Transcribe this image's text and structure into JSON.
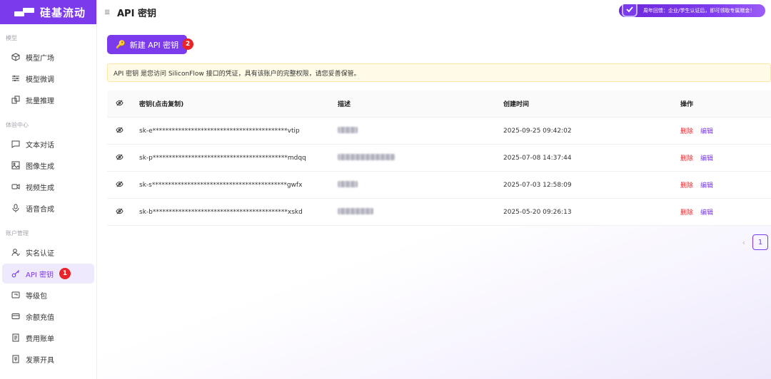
{
  "brand": {
    "name": "硅基流动"
  },
  "header": {
    "title": "API 密钥",
    "promo_text": "周年回馈：企业/学生认证后，即可领取专属赠金！"
  },
  "sidebar": {
    "sections": [
      {
        "title": "模型",
        "items": [
          {
            "label": "模型广场",
            "icon": "cube-icon"
          },
          {
            "label": "模型微调",
            "icon": "sliders-icon"
          },
          {
            "label": "批量推理",
            "icon": "layers-icon"
          }
        ]
      },
      {
        "title": "体验中心",
        "items": [
          {
            "label": "文本对话",
            "icon": "chat-icon"
          },
          {
            "label": "图像生成",
            "icon": "image-icon"
          },
          {
            "label": "视频生成",
            "icon": "video-icon"
          },
          {
            "label": "语音合成",
            "icon": "mic-icon"
          }
        ]
      },
      {
        "title": "账户管理",
        "items": [
          {
            "label": "实名认证",
            "icon": "user-check-icon"
          },
          {
            "label": "API 密钥",
            "icon": "key-icon",
            "active": true,
            "badge": "1"
          },
          {
            "label": "等级包",
            "icon": "package-icon"
          },
          {
            "label": "余额充值",
            "icon": "card-icon"
          },
          {
            "label": "费用账单",
            "icon": "bill-icon"
          },
          {
            "label": "发票开具",
            "icon": "invoice-icon"
          }
        ]
      }
    ]
  },
  "main": {
    "create_button": {
      "label": "新建 API 密钥",
      "badge": "2"
    },
    "notice": "API 密钥 是您访问 SiliconFlow 接口的凭证，具有该账户的完整权限，请您妥善保管。",
    "table": {
      "headers": {
        "key": "密钥(点击复制)",
        "desc": "描述",
        "created": "创建时间",
        "ops": "操作"
      },
      "rows": [
        {
          "key": "sk-e******************************************vtip",
          "created": "2025-09-25 09:42:02",
          "delete": "删除",
          "edit": "编辑"
        },
        {
          "key": "sk-p******************************************mdqq",
          "created": "2025-07-08 14:37:44",
          "delete": "删除",
          "edit": "编辑"
        },
        {
          "key": "sk-s******************************************gwfx",
          "created": "2025-07-03 12:58:09",
          "delete": "删除",
          "edit": "编辑"
        },
        {
          "key": "sk-b******************************************xskd",
          "created": "2025-05-20 09:26:13",
          "delete": "删除",
          "edit": "编辑"
        }
      ]
    },
    "pagination": {
      "current": "1",
      "prev": "‹"
    }
  },
  "colors": {
    "accent": "#7c3aed",
    "danger": "#e5252a",
    "notice_bg": "#fffbe6"
  }
}
